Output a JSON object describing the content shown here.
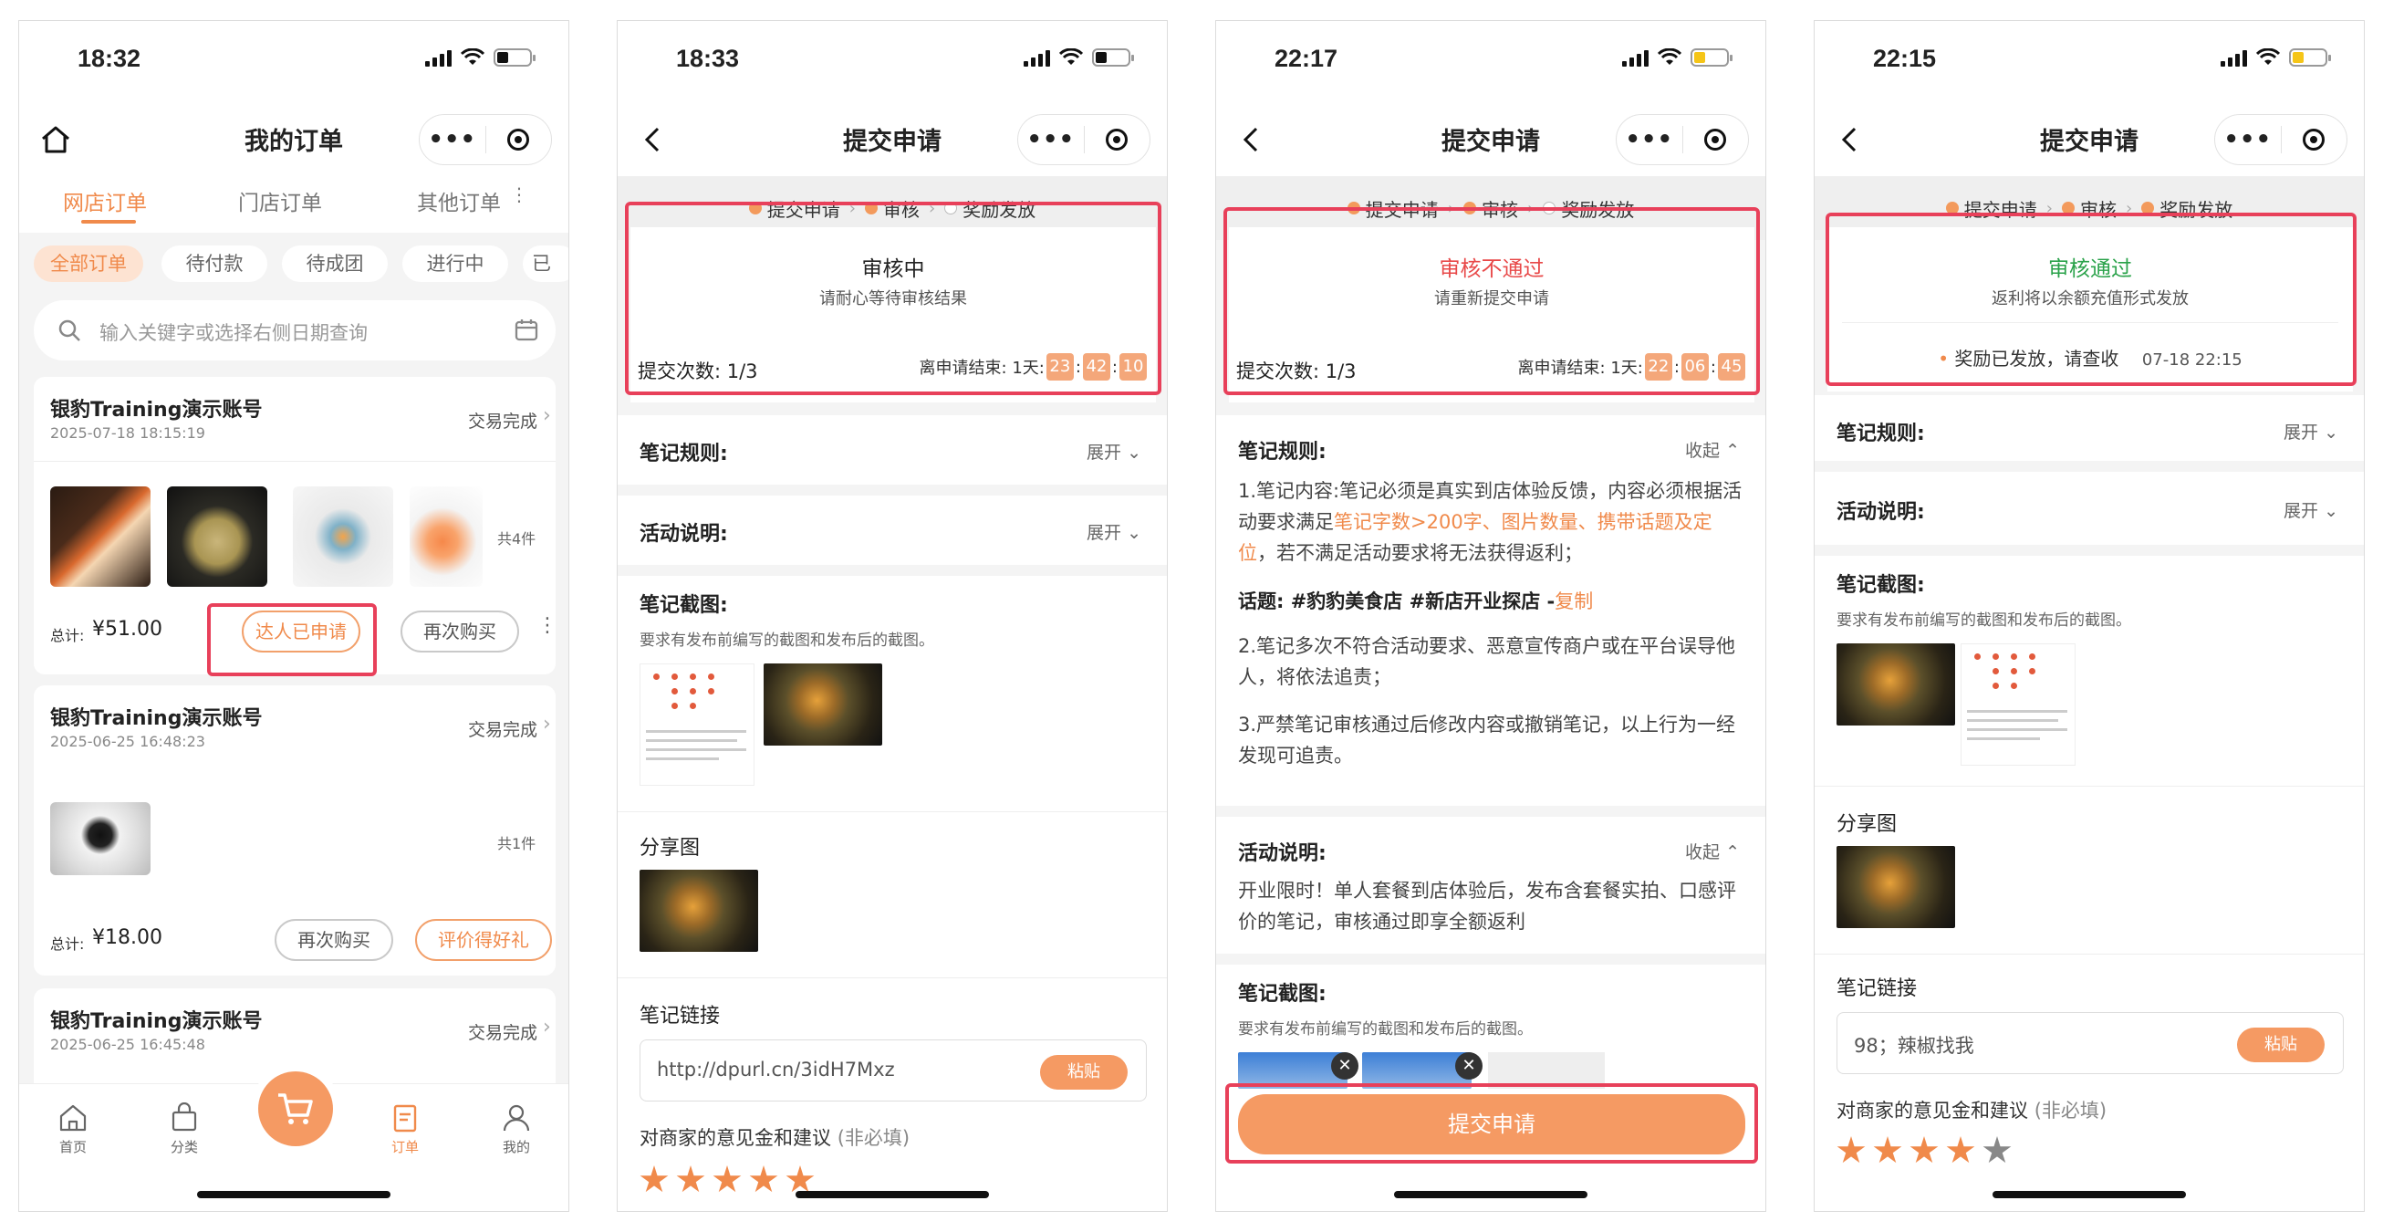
{
  "screens": [
    {
      "time": "18:32",
      "title": "我的订单",
      "tabs": [
        "网店订单",
        "门店订单",
        "其他订单"
      ],
      "filters": [
        "全部订单",
        "待付款",
        "待成团",
        "进行中",
        "已"
      ],
      "search_placeholder": "输入关键字或选择右侧日期查询",
      "orders": [
        {
          "shop": "银豹Training演示账号",
          "date": "2025-07-18 18:15:19",
          "status": "交易完成",
          "count": "共4件",
          "total_label": "总计:",
          "total": "¥51.00",
          "btn1": "达人已申请",
          "btn2": "再次购买"
        },
        {
          "shop": "银豹Training演示账号",
          "date": "2025-06-25 16:48:23",
          "status": "交易完成",
          "count": "共1件",
          "total_label": "总计:",
          "total": "¥18.00",
          "btn1": "再次购买",
          "btn2": "评价得好礼"
        },
        {
          "shop": "银豹Training演示账号",
          "date": "2025-06-25 16:45:48",
          "status": "交易完成"
        }
      ],
      "tabbar": [
        "首页",
        "分类",
        "订单",
        "我的"
      ]
    },
    {
      "time": "18:33",
      "title": "提交申请",
      "steps": [
        "提交申请",
        "审核",
        "奖励发放"
      ],
      "status_title": "审核中",
      "status_sub": "请耐心等待审核结果",
      "submit_count": "提交次数: 1/3",
      "deadline_label": "离申请结束: 1天:",
      "cd": [
        "23",
        "42",
        "10"
      ],
      "rules_label": "笔记规则:",
      "expand": "展开",
      "activity_label": "活动说明:",
      "screenshot_label": "笔记截图:",
      "screenshot_hint": "要求有发布前编写的截图和发布后的截图。",
      "share_label": "分享图",
      "link_label": "笔记链接",
      "link_value": "http://dpurl.cn/3idH7Mxz",
      "paste": "粘贴",
      "feedback_label": "对商家的意见金和建议",
      "optional": "(非必填)"
    },
    {
      "time": "22:17",
      "title": "提交申请",
      "steps": [
        "提交申请",
        "审核",
        "奖励发放"
      ],
      "status_title": "审核不通过",
      "status_sub": "请重新提交申请",
      "submit_count": "提交次数: 1/3",
      "deadline_label": "离申请结束: 1天:",
      "cd": [
        "22",
        "06",
        "45"
      ],
      "rules_label": "笔记规则:",
      "collapse": "收起",
      "rule1_a": "1.笔记内容:笔记必须是真实到店体验反馈，内容必须根据活动要求满足",
      "rule1_hl": "笔记字数>200字、图片数量、携带话题及定位",
      "rule1_b": "，若不满足活动要求将无法获得返利；",
      "topic": "话题: #豹豹美食店 #新店开业探店 -",
      "copy": "复制",
      "rule2": "2.笔记多次不符合活动要求、恶意宣传商户或在平台误导他人，将依法追责；",
      "rule3": "3.严禁笔记审核通过后修改内容或撤销笔记，以上行为一经发现可追责。",
      "activity_label": "活动说明:",
      "activity_text": "开业限时！单人套餐到店体验后，发布含套餐实拍、口感评价的笔记，审核通过即享全额返利",
      "screenshot_label": "笔记截图:",
      "screenshot_hint": "要求有发布前编写的截图和发布后的截图。",
      "submit_btn": "提交申请"
    },
    {
      "time": "22:15",
      "title": "提交申请",
      "steps": [
        "提交申请",
        "审核",
        "奖励发放"
      ],
      "status_title": "审核通过",
      "status_sub": "返利将以余额充值形式发放",
      "reward_text": "奖励已发放，请查收",
      "reward_time": "07-18 22:15",
      "rules_label": "笔记规则:",
      "expand": "展开",
      "activity_label": "活动说明:",
      "screenshot_label": "笔记截图:",
      "screenshot_hint": "要求有发布前编写的截图和发布后的截图。",
      "share_label": "分享图",
      "link_label": "笔记链接",
      "link_value": "98；辣椒找我",
      "paste": "粘贴",
      "feedback_label": "对商家的意见金和建议",
      "optional": "(非必填)"
    }
  ],
  "colors": {
    "accent": "#f08a4b",
    "highlight_box": "#e8405a",
    "approved": "#2aa24a",
    "rejected": "#e84848"
  }
}
